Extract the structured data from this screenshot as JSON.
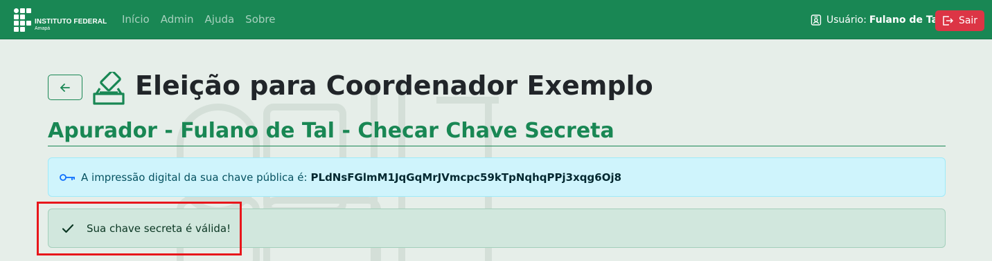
{
  "navbar": {
    "brand_title": "INSTITUTO FEDERAL",
    "brand_subtitle": "Amapá",
    "links": [
      "Início",
      "Admin",
      "Ajuda",
      "Sobre"
    ],
    "user_label": "Usuário:",
    "user_name": "Fulano de Tal",
    "logout_label": "Sair"
  },
  "header": {
    "title": "Eleição para Coordenador Exemplo",
    "subtitle": "Apurador - Fulano de Tal - Checar Chave Secreta"
  },
  "alerts": {
    "fingerprint_text": "A impressão digital da sua chave pública é:",
    "fingerprint_value": "PLdNsFGlmM1JqGqMrJVmcpc59kTpNqhqPPj3xqg6Oj8",
    "success_text": "Sua chave secreta é válida!"
  },
  "icons": {
    "logo": "if-grid-logo",
    "user": "person-badge-icon",
    "logout": "box-arrow-right-icon",
    "back": "arrow-left-icon",
    "ballot": "ballot-box-icon",
    "key": "key-icon",
    "check": "check-icon"
  },
  "colors": {
    "primary": "#198754",
    "danger": "#dc3545",
    "info_bg": "#cff4fc",
    "success_bg": "#d1e7dd",
    "highlight": "#e8161b"
  }
}
